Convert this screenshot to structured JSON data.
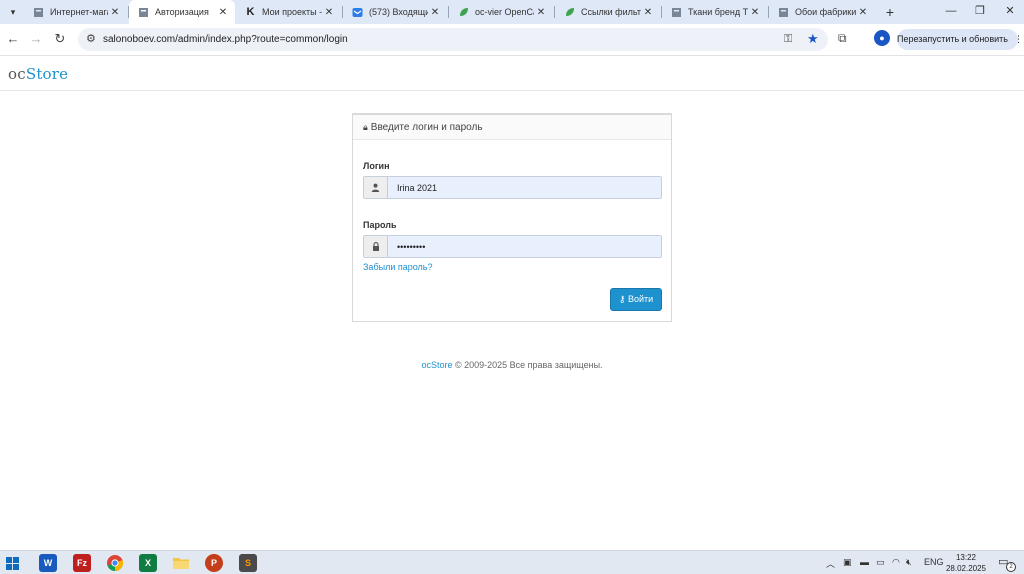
{
  "browser": {
    "tabs": [
      {
        "title": "Интернет-магаз",
        "icon": "page-icon"
      },
      {
        "title": "Авторизация",
        "icon": "page-icon",
        "active": true
      },
      {
        "title": "Мои проекты -",
        "icon": "k-logo-icon"
      },
      {
        "title": "(573) Входящие",
        "icon": "mail-icon"
      },
      {
        "title": "oc-vier OpenCar",
        "icon": "leaf-icon"
      },
      {
        "title": "Ссылки фильтр",
        "icon": "leaf-icon"
      },
      {
        "title": "Ткани бренд Та",
        "icon": "page-icon"
      },
      {
        "title": "Обои фабрики",
        "icon": "page-icon"
      }
    ],
    "tab_close_glyph": "✕",
    "new_tab_glyph": "+",
    "url": "salonoboev.com/admin/index.php?route=common/login",
    "relaunch_label": "Перезапустить и обновить",
    "relaunch_more": "⋮"
  },
  "page": {
    "logo": {
      "oc": "oc",
      "store": "Store"
    },
    "panel_title": "Введите логин и пароль",
    "username_label": "Логин",
    "username_value": "Irina 2021",
    "password_label": "Пароль",
    "password_value": "•••••••••",
    "forgot_link": "Забыли пароль?",
    "login_button": "Войти",
    "footer": {
      "brand": "ocStore",
      "text": "© 2009-2025 Все права защищены."
    }
  },
  "taskbar": {
    "apps": [
      {
        "name": "word",
        "letter": "W",
        "color": "#185abd"
      },
      {
        "name": "filezilla",
        "letter": "Fz",
        "color": "#bf1f1f"
      },
      {
        "name": "chrome",
        "letter": "",
        "color": "#ffffff"
      },
      {
        "name": "excel",
        "letter": "X",
        "color": "#107c41"
      },
      {
        "name": "explorer",
        "letter": "",
        "color": "#f4c542"
      },
      {
        "name": "powerpoint",
        "letter": "P",
        "color": "#c43e1c"
      },
      {
        "name": "sublime",
        "letter": "S",
        "color": "#4a4a4a"
      }
    ],
    "language": "ENG",
    "time": "13:22",
    "date": "28.02.2025",
    "notifications": "2"
  }
}
